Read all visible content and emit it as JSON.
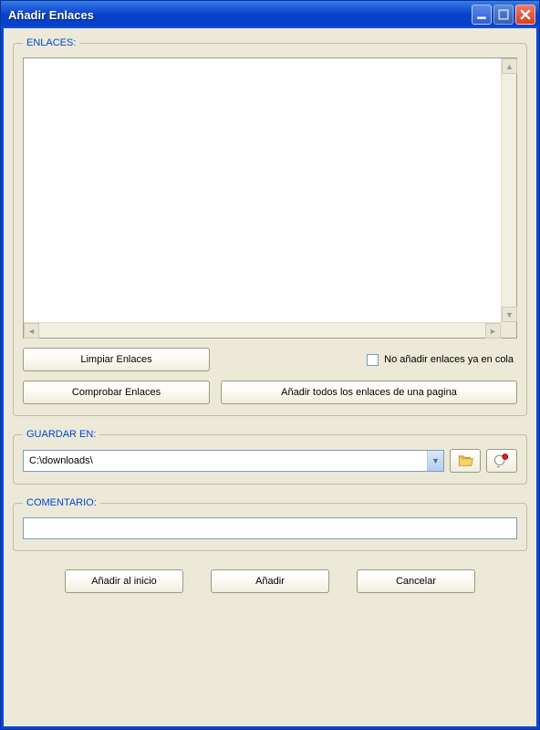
{
  "title": "Añadir Enlaces",
  "sections": {
    "links": {
      "legend": "ENLACES:"
    },
    "save": {
      "legend": "GUARDAR EN:",
      "path": "C:\\downloads\\"
    },
    "comment": {
      "legend": "COMENTARIO:",
      "value": ""
    }
  },
  "buttons": {
    "clear_links": "Limpiar Enlaces",
    "check_links": "Comprobar Enlaces",
    "add_all_from_page": "Añadir todos los enlaces de una pagina",
    "add_begin": "Añadir al inicio",
    "add": "Añadir",
    "cancel": "Cancelar"
  },
  "checkbox": {
    "no_queue_label": "No añadir enlaces ya en cola",
    "checked": false
  },
  "textarea_value": ""
}
